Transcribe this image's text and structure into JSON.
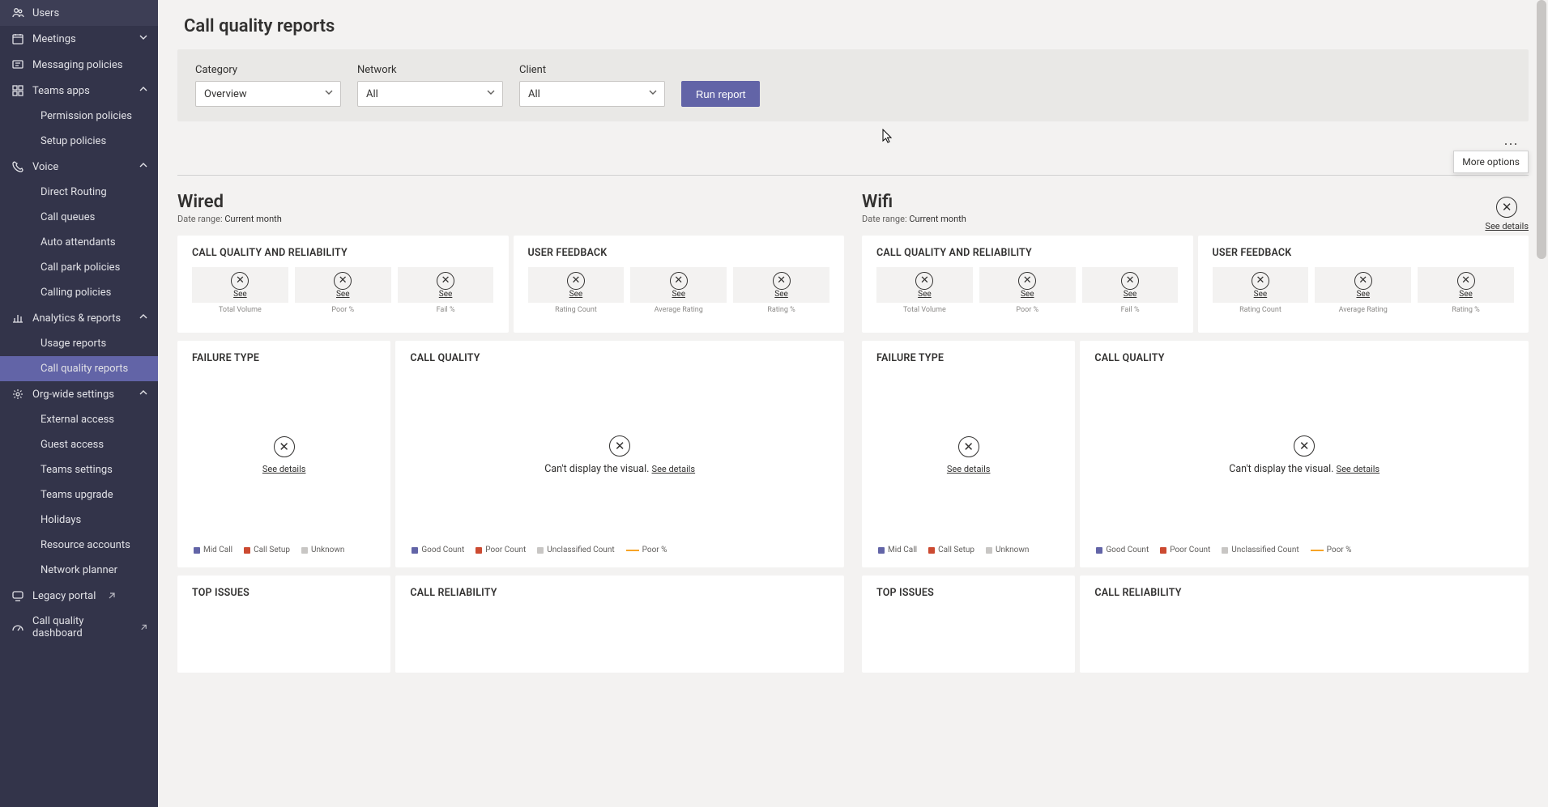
{
  "sidebar": {
    "items": [
      {
        "label": "Users",
        "icon": "users"
      },
      {
        "label": "Meetings",
        "icon": "calendar",
        "expandable": true
      },
      {
        "label": "Messaging policies",
        "icon": "message"
      },
      {
        "label": "Teams apps",
        "icon": "apps",
        "expandable": true,
        "expanded": true,
        "children": [
          {
            "label": "Permission policies"
          },
          {
            "label": "Setup policies"
          }
        ]
      },
      {
        "label": "Voice",
        "icon": "phone",
        "expandable": true,
        "expanded": true,
        "children": [
          {
            "label": "Direct Routing"
          },
          {
            "label": "Call queues"
          },
          {
            "label": "Auto attendants"
          },
          {
            "label": "Call park policies"
          },
          {
            "label": "Calling policies"
          }
        ]
      },
      {
        "label": "Analytics & reports",
        "icon": "analytics",
        "expandable": true,
        "expanded": true,
        "children": [
          {
            "label": "Usage reports"
          },
          {
            "label": "Call quality reports",
            "active": true
          }
        ]
      },
      {
        "label": "Org-wide settings",
        "icon": "gear",
        "expandable": true,
        "expanded": true,
        "children": [
          {
            "label": "External access"
          },
          {
            "label": "Guest access"
          },
          {
            "label": "Teams settings"
          },
          {
            "label": "Teams upgrade"
          },
          {
            "label": "Holidays"
          },
          {
            "label": "Resource accounts"
          },
          {
            "label": "Network planner"
          }
        ]
      },
      {
        "label": "Legacy portal",
        "icon": "legacy",
        "external": true
      },
      {
        "label": "Call quality dashboard",
        "icon": "speed",
        "external": true
      }
    ]
  },
  "page": {
    "title": "Call quality reports"
  },
  "filters": {
    "category": {
      "label": "Category",
      "value": "Overview"
    },
    "network": {
      "label": "Network",
      "value": "All"
    },
    "client": {
      "label": "Client",
      "value": "All"
    },
    "run": "Run report"
  },
  "more": {
    "tooltip": "More options"
  },
  "strings": {
    "date_range_label": "Date range: ",
    "date_range_value": "Current month",
    "see_details": "See details",
    "see": "See",
    "cant_display": "Can't display the visual. "
  },
  "cards": {
    "cqr": "CALL QUALITY AND RELIABILITY",
    "uf": "USER FEEDBACK",
    "ft": "FAILURE TYPE",
    "cq": "CALL QUALITY",
    "ti": "TOP ISSUES",
    "cr": "CALL RELIABILITY"
  },
  "cqr_metrics": [
    "Total Volume",
    "Poor %",
    "Fail %"
  ],
  "uf_metrics": [
    "Rating Count",
    "Average Rating",
    "Rating %"
  ],
  "legends": {
    "failure": [
      {
        "label": "Mid Call",
        "color": "#6264a7"
      },
      {
        "label": "Call Setup",
        "color": "#cc4a31"
      },
      {
        "label": "Unknown",
        "color": "#c8c6c4"
      }
    ],
    "quality": [
      {
        "label": "Good Count",
        "color": "#6264a7"
      },
      {
        "label": "Poor Count",
        "color": "#cc4a31"
      },
      {
        "label": "Unclassified Count",
        "color": "#c8c6c4"
      },
      {
        "label": "Poor %",
        "line": true
      }
    ]
  },
  "columns": [
    {
      "title": "Wired"
    },
    {
      "title": "Wifi"
    }
  ]
}
